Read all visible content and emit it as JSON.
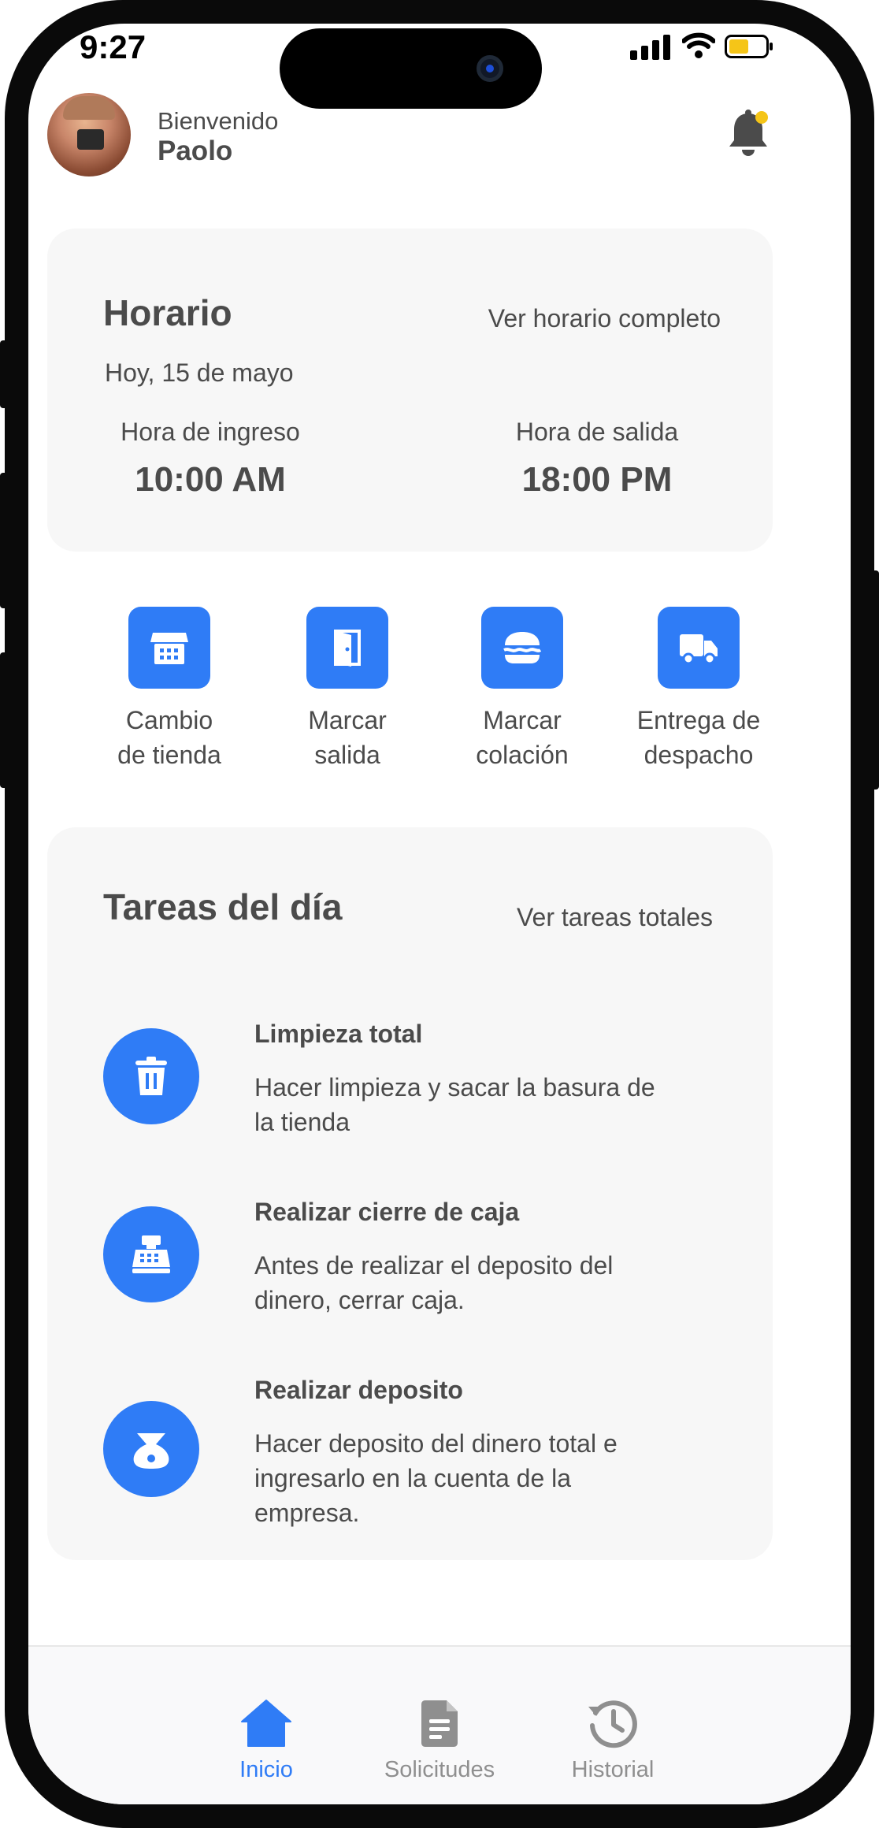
{
  "status_bar": {
    "time": "9:27"
  },
  "header": {
    "greeting": "Bienvenido",
    "user_name": "Paolo"
  },
  "schedule": {
    "title": "Horario",
    "link": "Ver horario completo",
    "date": "Hoy, 15 de mayo",
    "check_in": {
      "label": "Hora de ingreso",
      "value": "10:00 AM"
    },
    "check_out": {
      "label": "Hora de salida",
      "value": "18:00 PM"
    }
  },
  "actions": [
    {
      "line1": "Cambio",
      "line2": "de tienda",
      "icon": "store-icon"
    },
    {
      "line1": "Marcar",
      "line2": "salida",
      "icon": "door-icon"
    },
    {
      "line1": "Marcar",
      "line2": "colación",
      "icon": "burger-icon"
    },
    {
      "line1": "Entrega de",
      "line2": "despacho",
      "icon": "truck-icon"
    }
  ],
  "tasks": {
    "title": "Tareas del día",
    "link": "Ver tareas totales",
    "items": [
      {
        "title": "Limpieza total",
        "line1": "Hacer limpieza y sacar la basura de",
        "line2": "la tienda",
        "line3": "",
        "icon": "trash-icon"
      },
      {
        "title": "Realizar cierre de caja",
        "line1": "Antes de realizar el deposito del",
        "line2": "dinero, cerrar caja.",
        "line3": "",
        "icon": "cash-register-icon"
      },
      {
        "title": "Realizar deposito",
        "line1": "Hacer deposito del dinero total e",
        "line2": "ingresarlo en la cuenta de la",
        "line3": "empresa.",
        "icon": "money-bag-icon"
      }
    ]
  },
  "nav": {
    "items": [
      {
        "label": "Inicio",
        "icon": "home-icon",
        "active": true
      },
      {
        "label": "Solicitudes",
        "icon": "document-icon",
        "active": false
      },
      {
        "label": "Historial",
        "icon": "history-icon",
        "active": false
      }
    ]
  },
  "colors": {
    "accent": "#2f7cf6",
    "text": "#4b4b4b",
    "inactive": "#8f8f8f",
    "card": "#f7f7f7",
    "notification": "#f5c518"
  }
}
